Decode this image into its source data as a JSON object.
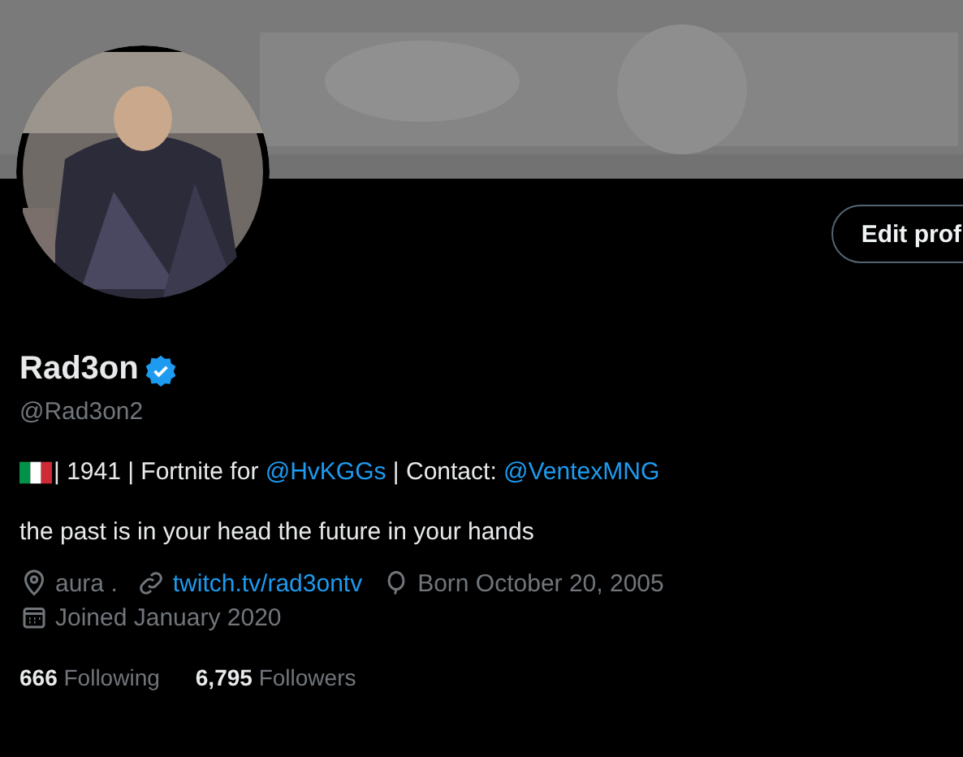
{
  "edit_button": {
    "label": "Edit prof"
  },
  "profile": {
    "name": "Rad3on",
    "verified": true,
    "handle": "@Rad3on2"
  },
  "bio": [
    {
      "kind": "flag"
    },
    {
      "kind": "text",
      "text": " | 1941 | Fortnite for "
    },
    {
      "kind": "mention",
      "text": "@HvKGGs"
    },
    {
      "kind": "text",
      "text": " | Contact: "
    },
    {
      "kind": "mention",
      "text": "@VentexMNG"
    }
  ],
  "quote": "the past is in your head the future in your hands",
  "meta": [
    {
      "kind": "location",
      "text": "aura ."
    },
    {
      "kind": "link",
      "text": "twitch.tv/rad3ontv"
    },
    {
      "kind": "birthday",
      "text": "Born October 20, 2005"
    },
    {
      "kind": "joined",
      "text": "Joined January 2020"
    }
  ],
  "stats": [
    {
      "count": "666",
      "label": "Following"
    },
    {
      "count": "6,795",
      "label": "Followers"
    }
  ]
}
